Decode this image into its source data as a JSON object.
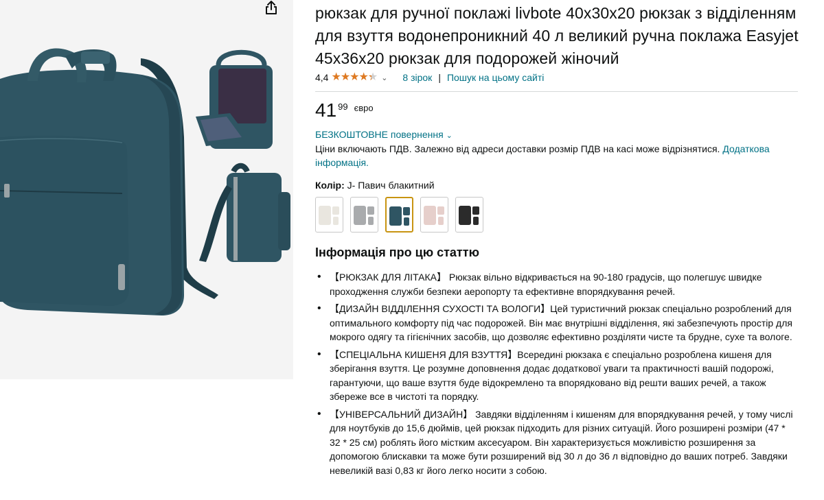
{
  "product": {
    "title": "рюкзак для ручної поклажі livbote 40x30x20 рюкзак з відділенням для взуття водонепроникний 40 л великий ручна поклажа Easyjet 45x36x20 рюкзак для подорожей жіночий",
    "rating": "4,4",
    "stars_value": 4.4,
    "stars_max": 5,
    "ratings_link": "8 зірок",
    "separator": "|",
    "search_link": "Пошук на цьому сайті",
    "price_whole": "41",
    "price_fraction": "99",
    "price_currency": "євро",
    "returns_link": "БЕЗКОШТОВНЕ повернення",
    "vat_text": "Ціни включають ПДВ. Залежно від адреси доставки розмір ПДВ на касі може відрізнятися.",
    "vat_link": "Додаткова інформація.",
    "color_label": "Колір:",
    "color_value": "J- Павич блакитний"
  },
  "swatches": [
    {
      "color": "#e9e6df",
      "selected": false
    },
    {
      "color": "#a9abad",
      "selected": false
    },
    {
      "color": "#2f5563",
      "selected": true
    },
    {
      "color": "#e6cfcb",
      "selected": false
    },
    {
      "color": "#2b2b2b",
      "selected": false
    }
  ],
  "about": {
    "title": "Інформація про цю статтю",
    "bullets": [
      "【РЮКЗАК ДЛЯ ЛІТАКА】 Рюкзак вільно відкривається на 90-180 градусів, що полегшує швидке проходження служби безпеки аеропорту та ефективне впорядкування речей.",
      "【ДИЗАЙН ВІДДІЛЕННЯ СУХОСТІ ТА ВОЛОГИ】Цей туристичний рюкзак спеціально розроблений для оптимального комфорту під час подорожей. Він має внутрішні відділення, які забезпечують простір для мокрого одягу та гігієнічних засобів, що дозволяє ефективно розділяти чисте та брудне, сухе та вологе.",
      "【СПЕЦІАЛЬНА КИШЕНЯ ДЛЯ ВЗУТТЯ】Всередині рюкзака є спеціально розроблена кишеня для зберігання взуття. Це розумне доповнення додає додаткової уваги та практичності вашій подорожі, гарантуючи, що ваше взуття буде відокремлено та впорядковано від решти ваших речей, а також збереже все в чистоті та порядку.",
      "【УНІВЕРСАЛЬНИЙ ДИЗАЙН】 Завдяки відділенням і кишеням для впорядкування речей, у тому числі для ноутбуків до 15,6 дюймів, цей рюкзак підходить для різних ситуацій. Його розширені розміри (47 * 32 * 25 см) роблять його містким аксесуаром. Він характеризується можливістю розширення за допомогою блискавки та може бути розширений від 30 л до 36 л відповідно до ваших потреб. Завдяки невеликій вазі 0,83 кг його легко носити з собою."
    ]
  },
  "icons": {
    "share": "share-icon",
    "star": "star-icon",
    "chevron": "chevron-down-icon"
  },
  "colors": {
    "link": "#007185",
    "star": "#de7921",
    "selected_border": "#c89411",
    "backpack": "#2f5563"
  }
}
